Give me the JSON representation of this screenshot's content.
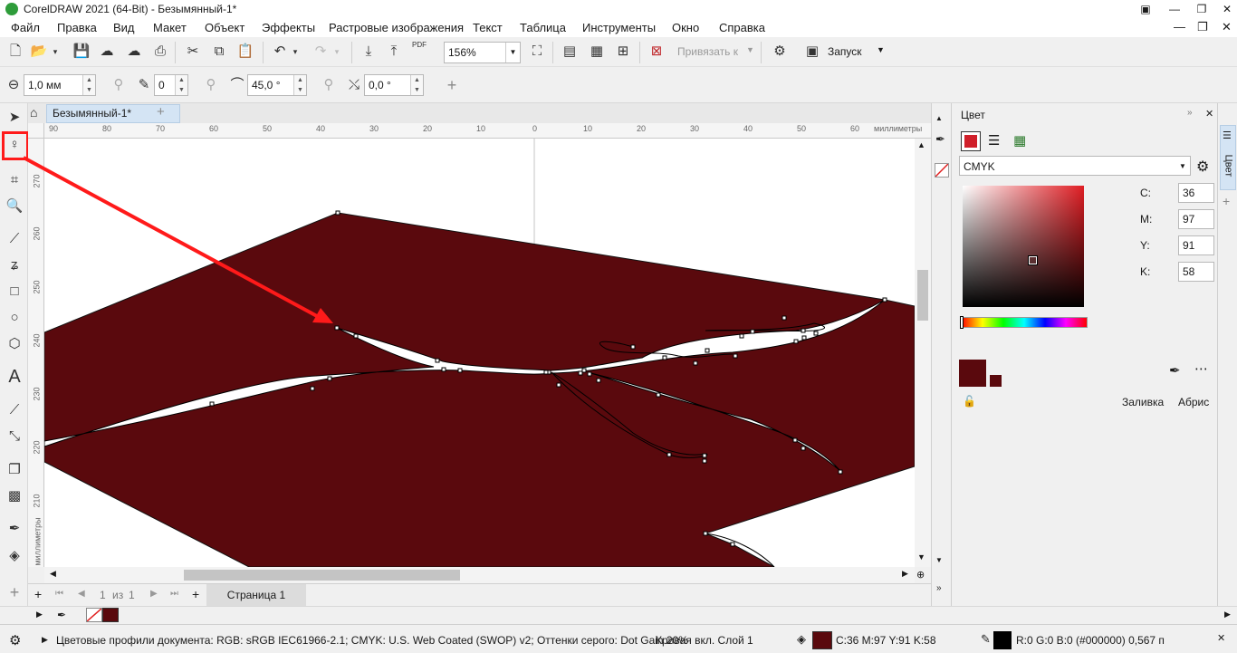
{
  "window": {
    "title": "CorelDRAW 2021 (64-Bit) - Безымянный-1*",
    "minimize_icon": "minimize-icon",
    "restore_icon": "restore-icon",
    "close_icon": "close-icon"
  },
  "menu": {
    "items": [
      "Файл",
      "Правка",
      "Вид",
      "Макет",
      "Объект",
      "Эффекты",
      "Растровые изображения",
      "Текст",
      "Таблица",
      "Инструменты",
      "Окно",
      "Справка"
    ]
  },
  "toolbar1": {
    "zoom": "156%",
    "snap_label": "Привязать к",
    "launch_label": "Запуск",
    "pdf_label": "PDF"
  },
  "toolbar2": {
    "outline_width": "1,0 мм",
    "nib_value": "0",
    "angle_value": "45,0 °",
    "rotation_value": "0,0 °"
  },
  "document": {
    "tab_label": "Безымянный-1*",
    "ruler_unit": "миллиметры",
    "ruler_h_labels": [
      "90",
      "80",
      "70",
      "60",
      "50",
      "40",
      "30",
      "20",
      "10",
      "0",
      "10",
      "20",
      "30",
      "40",
      "50",
      "60"
    ],
    "ruler_v_labels": [
      "270",
      "260",
      "250",
      "240",
      "230",
      "220",
      "210"
    ],
    "shape_color": "#5a090d"
  },
  "pages": {
    "current": "1",
    "of_label": "из",
    "total": "1",
    "page_tab": "Страница 1"
  },
  "docker": {
    "title": "Цвет",
    "model": "CMYK",
    "c_label": "C:",
    "m_label": "M:",
    "y_label": "Y:",
    "k_label": "K:",
    "c": "36",
    "m": "97",
    "y": "91",
    "k": "58",
    "fill_label": "Заливка",
    "outline_label": "Абрис",
    "current_color": "#5a090d",
    "side_tab": "Цвет"
  },
  "status": {
    "profiles": "Цветовые профили документа: RGB: sRGB IEC61966-2.1; CMYK: U.S. Web Coated (SWOP) v2; Оттенки серого: Dot Gain 20%",
    "object_info": "Кривая вкл. Слой 1",
    "fill_info": "C:36 M:97 Y:91 K:58",
    "outline_info": "R:0 G:0 B:0 (#000000)  0,567 п"
  }
}
